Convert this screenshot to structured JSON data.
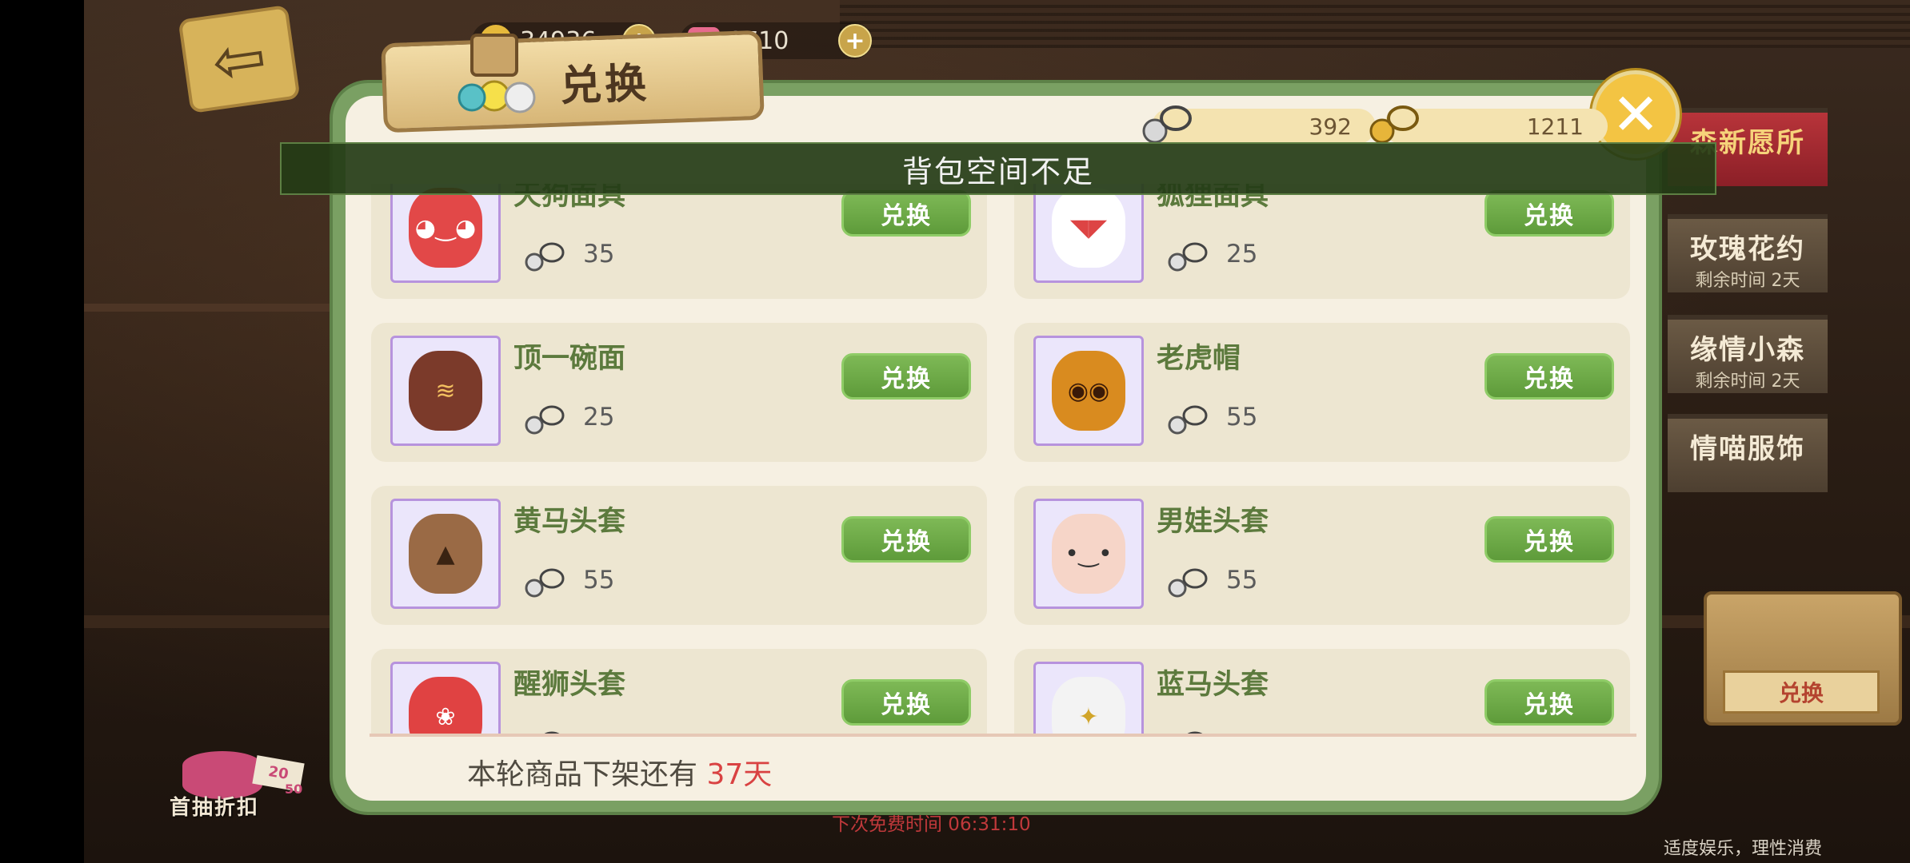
{
  "currencies": [
    {
      "icon": "gold-coin-icon",
      "value": "34936"
    },
    {
      "icon": "pink-gem-icon",
      "value": "1710"
    }
  ],
  "dialog": {
    "title": "兑换",
    "tokens": [
      {
        "icon": "silver-key-token-icon",
        "value": "392"
      },
      {
        "icon": "gold-key-token-icon",
        "value": "1211"
      }
    ],
    "toast": "背包空间不足",
    "countdown_prefix": "本轮商品下架还有",
    "countdown_days": "37天",
    "items": [
      {
        "name": "天狗面具",
        "cost": "35",
        "button": "兑换",
        "icon": "tengu-mask-icon"
      },
      {
        "name": "狐狸面具",
        "cost": "25",
        "button": "兑换",
        "icon": "fox-mask-icon"
      },
      {
        "name": "顶一碗面",
        "cost": "25",
        "button": "兑换",
        "icon": "noodle-bowl-icon"
      },
      {
        "name": "老虎帽",
        "cost": "55",
        "button": "兑换",
        "icon": "tiger-hat-icon"
      },
      {
        "name": "黄马头套",
        "cost": "55",
        "button": "兑换",
        "icon": "horse-head-icon"
      },
      {
        "name": "男娃头套",
        "cost": "55",
        "button": "兑换",
        "icon": "baby-boy-head-icon"
      },
      {
        "name": "醒狮头套",
        "cost": "",
        "button": "兑换",
        "icon": "lion-dance-head-icon"
      },
      {
        "name": "蓝马头套",
        "cost": "",
        "button": "兑换",
        "icon": "unicorn-head-icon"
      }
    ]
  },
  "side_tabs": [
    {
      "title": "森新愿所",
      "sub": ""
    },
    {
      "title": "玫瑰花约",
      "sub": "剩余时间 2天"
    },
    {
      "title": "缘情小森",
      "sub": "剩余时间 2天"
    },
    {
      "title": "情喵服饰",
      "sub": ""
    }
  ],
  "box_button_label": "兑换",
  "gift": {
    "label": "首抽折扣",
    "tag_top": "20",
    "tag_bottom": "50"
  },
  "free_time": "下次免费时间  06:31:10",
  "footer_note": "适度娱乐，理性消费",
  "colors": {
    "accent_green": "#6aa845",
    "countdown_red": "#d94242",
    "item_name_green": "#5c7a3d"
  }
}
